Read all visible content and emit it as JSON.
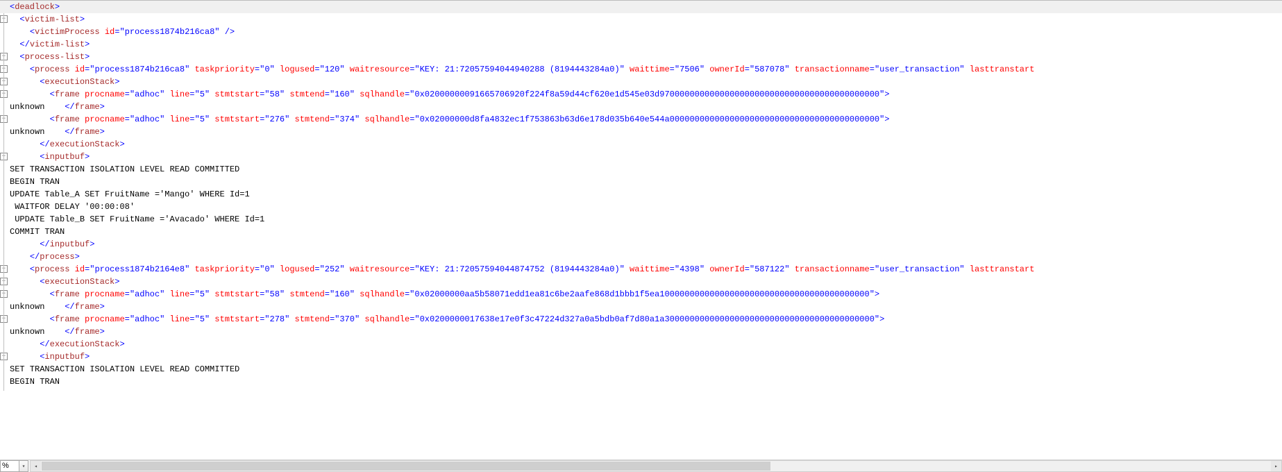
{
  "zoom": "%",
  "lines": [
    {
      "type": "xml",
      "hl": true,
      "fold": true,
      "parts": [
        {
          "c": "p",
          "s": "<"
        },
        {
          "c": "t",
          "s": "deadlock"
        },
        {
          "c": "p",
          "s": ">"
        }
      ]
    },
    {
      "type": "xml",
      "fold": true,
      "indent": 1,
      "parts": [
        {
          "c": "p",
          "s": "<"
        },
        {
          "c": "t",
          "s": "victim-list"
        },
        {
          "c": "p",
          "s": ">"
        }
      ]
    },
    {
      "type": "xml",
      "indent": 2,
      "parts": [
        {
          "c": "p",
          "s": "<"
        },
        {
          "c": "t",
          "s": "victimProcess"
        },
        {
          "c": "tx",
          "s": " "
        },
        {
          "c": "a",
          "s": "id"
        },
        {
          "c": "p",
          "s": "="
        },
        {
          "c": "p",
          "s": "\""
        },
        {
          "c": "v",
          "s": "process1874b216ca8"
        },
        {
          "c": "p",
          "s": "\""
        },
        {
          "c": "tx",
          "s": " "
        },
        {
          "c": "p",
          "s": "/>"
        }
      ]
    },
    {
      "type": "xml",
      "indent": 1,
      "parts": [
        {
          "c": "p",
          "s": "</"
        },
        {
          "c": "t",
          "s": "victim-list"
        },
        {
          "c": "p",
          "s": ">"
        }
      ]
    },
    {
      "type": "xml",
      "fold": true,
      "indent": 1,
      "parts": [
        {
          "c": "p",
          "s": "<"
        },
        {
          "c": "t",
          "s": "process-list"
        },
        {
          "c": "p",
          "s": ">"
        }
      ]
    },
    {
      "type": "xml",
      "fold": true,
      "indent": 2,
      "parts": [
        {
          "c": "p",
          "s": "<"
        },
        {
          "c": "t",
          "s": "process"
        },
        {
          "c": "tx",
          "s": " "
        },
        {
          "c": "a",
          "s": "id"
        },
        {
          "c": "p",
          "s": "=\""
        },
        {
          "c": "v",
          "s": "process1874b216ca8"
        },
        {
          "c": "p",
          "s": "\" "
        },
        {
          "c": "a",
          "s": "taskpriority"
        },
        {
          "c": "p",
          "s": "=\""
        },
        {
          "c": "v",
          "s": "0"
        },
        {
          "c": "p",
          "s": "\" "
        },
        {
          "c": "a",
          "s": "logused"
        },
        {
          "c": "p",
          "s": "=\""
        },
        {
          "c": "v",
          "s": "120"
        },
        {
          "c": "p",
          "s": "\" "
        },
        {
          "c": "a",
          "s": "waitresource"
        },
        {
          "c": "p",
          "s": "=\""
        },
        {
          "c": "v",
          "s": "KEY: 21:72057594044940288 (8194443284a0)"
        },
        {
          "c": "p",
          "s": "\" "
        },
        {
          "c": "a",
          "s": "waittime"
        },
        {
          "c": "p",
          "s": "=\""
        },
        {
          "c": "v",
          "s": "7506"
        },
        {
          "c": "p",
          "s": "\" "
        },
        {
          "c": "a",
          "s": "ownerId"
        },
        {
          "c": "p",
          "s": "=\""
        },
        {
          "c": "v",
          "s": "587078"
        },
        {
          "c": "p",
          "s": "\" "
        },
        {
          "c": "a",
          "s": "transactionname"
        },
        {
          "c": "p",
          "s": "=\""
        },
        {
          "c": "v",
          "s": "user_transaction"
        },
        {
          "c": "p",
          "s": "\" "
        },
        {
          "c": "a",
          "s": "lasttranstart"
        }
      ]
    },
    {
      "type": "xml",
      "fold": true,
      "indent": 3,
      "parts": [
        {
          "c": "p",
          "s": "<"
        },
        {
          "c": "t",
          "s": "executionStack"
        },
        {
          "c": "p",
          "s": ">"
        }
      ]
    },
    {
      "type": "xml",
      "fold": true,
      "indent": 4,
      "parts": [
        {
          "c": "p",
          "s": "<"
        },
        {
          "c": "t",
          "s": "frame"
        },
        {
          "c": "tx",
          "s": " "
        },
        {
          "c": "a",
          "s": "procname"
        },
        {
          "c": "p",
          "s": "=\""
        },
        {
          "c": "v",
          "s": "adhoc"
        },
        {
          "c": "p",
          "s": "\" "
        },
        {
          "c": "a",
          "s": "line"
        },
        {
          "c": "p",
          "s": "=\""
        },
        {
          "c": "v",
          "s": "5"
        },
        {
          "c": "p",
          "s": "\" "
        },
        {
          "c": "a",
          "s": "stmtstart"
        },
        {
          "c": "p",
          "s": "=\""
        },
        {
          "c": "v",
          "s": "58"
        },
        {
          "c": "p",
          "s": "\" "
        },
        {
          "c": "a",
          "s": "stmtend"
        },
        {
          "c": "p",
          "s": "=\""
        },
        {
          "c": "v",
          "s": "160"
        },
        {
          "c": "p",
          "s": "\" "
        },
        {
          "c": "a",
          "s": "sqlhandle"
        },
        {
          "c": "p",
          "s": "=\""
        },
        {
          "c": "v",
          "s": "0x02000000091665706920f224f8a59d44cf620e1d545e03d97000000000000000000000000000000000000000000"
        },
        {
          "c": "p",
          "s": "\">"
        }
      ]
    },
    {
      "type": "close",
      "parts": [
        {
          "c": "tx",
          "s": "unknown    "
        },
        {
          "c": "p",
          "s": "</"
        },
        {
          "c": "t",
          "s": "frame"
        },
        {
          "c": "p",
          "s": ">"
        }
      ]
    },
    {
      "type": "xml",
      "fold": true,
      "indent": 4,
      "parts": [
        {
          "c": "p",
          "s": "<"
        },
        {
          "c": "t",
          "s": "frame"
        },
        {
          "c": "tx",
          "s": " "
        },
        {
          "c": "a",
          "s": "procname"
        },
        {
          "c": "p",
          "s": "=\""
        },
        {
          "c": "v",
          "s": "adhoc"
        },
        {
          "c": "p",
          "s": "\" "
        },
        {
          "c": "a",
          "s": "line"
        },
        {
          "c": "p",
          "s": "=\""
        },
        {
          "c": "v",
          "s": "5"
        },
        {
          "c": "p",
          "s": "\" "
        },
        {
          "c": "a",
          "s": "stmtstart"
        },
        {
          "c": "p",
          "s": "=\""
        },
        {
          "c": "v",
          "s": "276"
        },
        {
          "c": "p",
          "s": "\" "
        },
        {
          "c": "a",
          "s": "stmtend"
        },
        {
          "c": "p",
          "s": "=\""
        },
        {
          "c": "v",
          "s": "374"
        },
        {
          "c": "p",
          "s": "\" "
        },
        {
          "c": "a",
          "s": "sqlhandle"
        },
        {
          "c": "p",
          "s": "=\""
        },
        {
          "c": "v",
          "s": "0x02000000d8fa4832ec1f753863b63d6e178d035b640e544a000000000000000000000000000000000000000000"
        },
        {
          "c": "p",
          "s": "\">"
        }
      ]
    },
    {
      "type": "close",
      "parts": [
        {
          "c": "tx",
          "s": "unknown    "
        },
        {
          "c": "p",
          "s": "</"
        },
        {
          "c": "t",
          "s": "frame"
        },
        {
          "c": "p",
          "s": ">"
        }
      ]
    },
    {
      "type": "xml",
      "indent": 3,
      "parts": [
        {
          "c": "p",
          "s": "</"
        },
        {
          "c": "t",
          "s": "executionStack"
        },
        {
          "c": "p",
          "s": ">"
        }
      ]
    },
    {
      "type": "xml",
      "fold": true,
      "indent": 3,
      "parts": [
        {
          "c": "p",
          "s": "<"
        },
        {
          "c": "t",
          "s": "inputbuf"
        },
        {
          "c": "p",
          "s": ">"
        }
      ]
    },
    {
      "type": "plain",
      "parts": [
        {
          "c": "tx",
          "s": "SET TRANSACTION ISOLATION LEVEL READ COMMITTED"
        }
      ]
    },
    {
      "type": "plain",
      "parts": [
        {
          "c": "tx",
          "s": "BEGIN TRAN"
        }
      ]
    },
    {
      "type": "plain",
      "parts": [
        {
          "c": "tx",
          "s": "UPDATE Table_A SET FruitName ='Mango' WHERE Id=1"
        }
      ]
    },
    {
      "type": "plain",
      "parts": [
        {
          "c": "tx",
          "s": " WAITFOR DELAY '00:00:08'"
        }
      ]
    },
    {
      "type": "plain",
      "parts": [
        {
          "c": "tx",
          "s": " UPDATE Table_B SET FruitName ='Avacado' WHERE Id=1"
        }
      ]
    },
    {
      "type": "plain",
      "parts": [
        {
          "c": "tx",
          "s": "COMMIT TRAN"
        }
      ]
    },
    {
      "type": "xml",
      "indent": 3,
      "parts": [
        {
          "c": "p",
          "s": "</"
        },
        {
          "c": "t",
          "s": "inputbuf"
        },
        {
          "c": "p",
          "s": ">"
        }
      ]
    },
    {
      "type": "xml",
      "indent": 2,
      "parts": [
        {
          "c": "p",
          "s": "</"
        },
        {
          "c": "t",
          "s": "process"
        },
        {
          "c": "p",
          "s": ">"
        }
      ]
    },
    {
      "type": "xml",
      "fold": true,
      "indent": 2,
      "parts": [
        {
          "c": "p",
          "s": "<"
        },
        {
          "c": "t",
          "s": "process"
        },
        {
          "c": "tx",
          "s": " "
        },
        {
          "c": "a",
          "s": "id"
        },
        {
          "c": "p",
          "s": "=\""
        },
        {
          "c": "v",
          "s": "process1874b2164e8"
        },
        {
          "c": "p",
          "s": "\" "
        },
        {
          "c": "a",
          "s": "taskpriority"
        },
        {
          "c": "p",
          "s": "=\""
        },
        {
          "c": "v",
          "s": "0"
        },
        {
          "c": "p",
          "s": "\" "
        },
        {
          "c": "a",
          "s": "logused"
        },
        {
          "c": "p",
          "s": "=\""
        },
        {
          "c": "v",
          "s": "252"
        },
        {
          "c": "p",
          "s": "\" "
        },
        {
          "c": "a",
          "s": "waitresource"
        },
        {
          "c": "p",
          "s": "=\""
        },
        {
          "c": "v",
          "s": "KEY: 21:72057594044874752 (8194443284a0)"
        },
        {
          "c": "p",
          "s": "\" "
        },
        {
          "c": "a",
          "s": "waittime"
        },
        {
          "c": "p",
          "s": "=\""
        },
        {
          "c": "v",
          "s": "4398"
        },
        {
          "c": "p",
          "s": "\" "
        },
        {
          "c": "a",
          "s": "ownerId"
        },
        {
          "c": "p",
          "s": "=\""
        },
        {
          "c": "v",
          "s": "587122"
        },
        {
          "c": "p",
          "s": "\" "
        },
        {
          "c": "a",
          "s": "transactionname"
        },
        {
          "c": "p",
          "s": "=\""
        },
        {
          "c": "v",
          "s": "user_transaction"
        },
        {
          "c": "p",
          "s": "\" "
        },
        {
          "c": "a",
          "s": "lasttranstart"
        }
      ]
    },
    {
      "type": "xml",
      "fold": true,
      "indent": 3,
      "parts": [
        {
          "c": "p",
          "s": "<"
        },
        {
          "c": "t",
          "s": "executionStack"
        },
        {
          "c": "p",
          "s": ">"
        }
      ]
    },
    {
      "type": "xml",
      "fold": true,
      "indent": 4,
      "parts": [
        {
          "c": "p",
          "s": "<"
        },
        {
          "c": "t",
          "s": "frame"
        },
        {
          "c": "tx",
          "s": " "
        },
        {
          "c": "a",
          "s": "procname"
        },
        {
          "c": "p",
          "s": "=\""
        },
        {
          "c": "v",
          "s": "adhoc"
        },
        {
          "c": "p",
          "s": "\" "
        },
        {
          "c": "a",
          "s": "line"
        },
        {
          "c": "p",
          "s": "=\""
        },
        {
          "c": "v",
          "s": "5"
        },
        {
          "c": "p",
          "s": "\" "
        },
        {
          "c": "a",
          "s": "stmtstart"
        },
        {
          "c": "p",
          "s": "=\""
        },
        {
          "c": "v",
          "s": "58"
        },
        {
          "c": "p",
          "s": "\" "
        },
        {
          "c": "a",
          "s": "stmtend"
        },
        {
          "c": "p",
          "s": "=\""
        },
        {
          "c": "v",
          "s": "160"
        },
        {
          "c": "p",
          "s": "\" "
        },
        {
          "c": "a",
          "s": "sqlhandle"
        },
        {
          "c": "p",
          "s": "=\""
        },
        {
          "c": "v",
          "s": "0x02000000aa5b58071edd1ea81c6be2aafe868d1bbb1f5ea100000000000000000000000000000000000000000"
        },
        {
          "c": "p",
          "s": "\">"
        }
      ]
    },
    {
      "type": "close",
      "parts": [
        {
          "c": "tx",
          "s": "unknown    "
        },
        {
          "c": "p",
          "s": "</"
        },
        {
          "c": "t",
          "s": "frame"
        },
        {
          "c": "p",
          "s": ">"
        }
      ]
    },
    {
      "type": "xml",
      "fold": true,
      "indent": 4,
      "parts": [
        {
          "c": "p",
          "s": "<"
        },
        {
          "c": "t",
          "s": "frame"
        },
        {
          "c": "tx",
          "s": " "
        },
        {
          "c": "a",
          "s": "procname"
        },
        {
          "c": "p",
          "s": "=\""
        },
        {
          "c": "v",
          "s": "adhoc"
        },
        {
          "c": "p",
          "s": "\" "
        },
        {
          "c": "a",
          "s": "line"
        },
        {
          "c": "p",
          "s": "=\""
        },
        {
          "c": "v",
          "s": "5"
        },
        {
          "c": "p",
          "s": "\" "
        },
        {
          "c": "a",
          "s": "stmtstart"
        },
        {
          "c": "p",
          "s": "=\""
        },
        {
          "c": "v",
          "s": "278"
        },
        {
          "c": "p",
          "s": "\" "
        },
        {
          "c": "a",
          "s": "stmtend"
        },
        {
          "c": "p",
          "s": "=\""
        },
        {
          "c": "v",
          "s": "370"
        },
        {
          "c": "p",
          "s": "\" "
        },
        {
          "c": "a",
          "s": "sqlhandle"
        },
        {
          "c": "p",
          "s": "=\""
        },
        {
          "c": "v",
          "s": "0x0200000017638e17e0f3c47224d327a0a5bdb0af7d80a1a300000000000000000000000000000000000000000"
        },
        {
          "c": "p",
          "s": "\">"
        }
      ]
    },
    {
      "type": "close",
      "parts": [
        {
          "c": "tx",
          "s": "unknown    "
        },
        {
          "c": "p",
          "s": "</"
        },
        {
          "c": "t",
          "s": "frame"
        },
        {
          "c": "p",
          "s": ">"
        }
      ]
    },
    {
      "type": "xml",
      "indent": 3,
      "parts": [
        {
          "c": "p",
          "s": "</"
        },
        {
          "c": "t",
          "s": "executionStack"
        },
        {
          "c": "p",
          "s": ">"
        }
      ]
    },
    {
      "type": "xml",
      "fold": true,
      "indent": 3,
      "parts": [
        {
          "c": "p",
          "s": "<"
        },
        {
          "c": "t",
          "s": "inputbuf"
        },
        {
          "c": "p",
          "s": ">"
        }
      ]
    },
    {
      "type": "plain",
      "parts": [
        {
          "c": "tx",
          "s": "SET TRANSACTION ISOLATION LEVEL READ COMMITTED"
        }
      ]
    },
    {
      "type": "plain",
      "parts": [
        {
          "c": "tx",
          "s": "BEGIN TRAN"
        }
      ]
    }
  ]
}
